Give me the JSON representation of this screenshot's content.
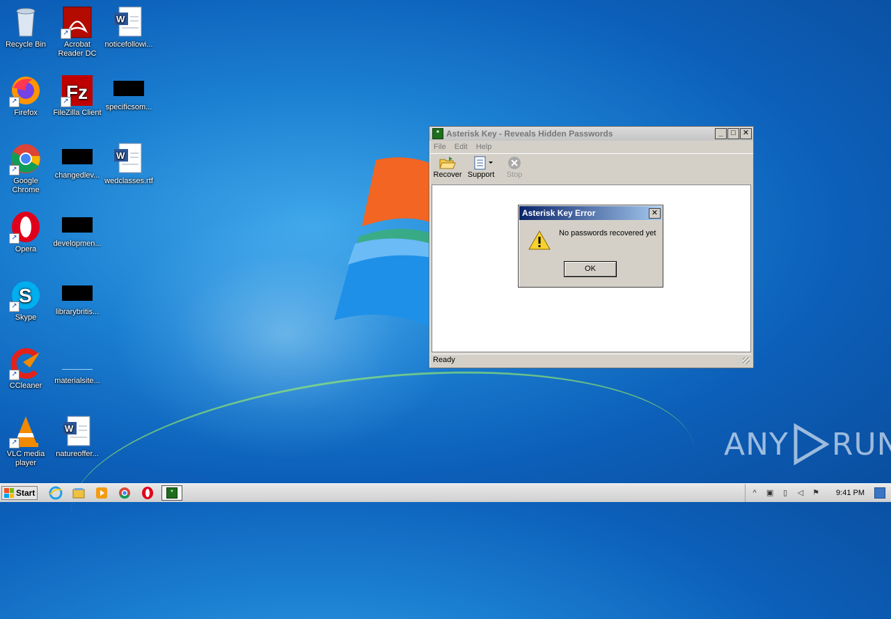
{
  "desktop": {
    "icons": [
      {
        "label": "Recycle Bin"
      },
      {
        "label": "Acrobat Reader DC"
      },
      {
        "label": "noticefollowi..."
      },
      {
        "label": "Firefox"
      },
      {
        "label": "FileZilla Client"
      },
      {
        "label": "specificsom..."
      },
      {
        "label": "Google Chrome"
      },
      {
        "label": "changedlev..."
      },
      {
        "label": "wedclasses.rtf"
      },
      {
        "label": "Opera"
      },
      {
        "label": "developmen..."
      },
      {
        "label": "Skype"
      },
      {
        "label": "librarybritis..."
      },
      {
        "label": "CCleaner"
      },
      {
        "label": "materialsite..."
      },
      {
        "label": "VLC media player"
      },
      {
        "label": "natureoffer..."
      }
    ]
  },
  "main_window": {
    "title": "Asterisk Key - Reveals Hidden Passwords",
    "menu": [
      "File",
      "Edit",
      "Help"
    ],
    "toolbar": [
      {
        "label": "Recover",
        "icon": "folder-open-icon"
      },
      {
        "label": "Support",
        "icon": "support-document-icon"
      },
      {
        "label": "Stop",
        "icon": "stop-icon"
      }
    ],
    "status": "Ready"
  },
  "dialog": {
    "title": "Asterisk Key Error",
    "message": "No passwords recovered yet",
    "ok_label": "OK",
    "close_glyph": "✕"
  },
  "taskbar": {
    "start_label": "Start",
    "clock": "9:41 PM"
  },
  "watermark": {
    "left": "ANY",
    "right": "RUN"
  }
}
